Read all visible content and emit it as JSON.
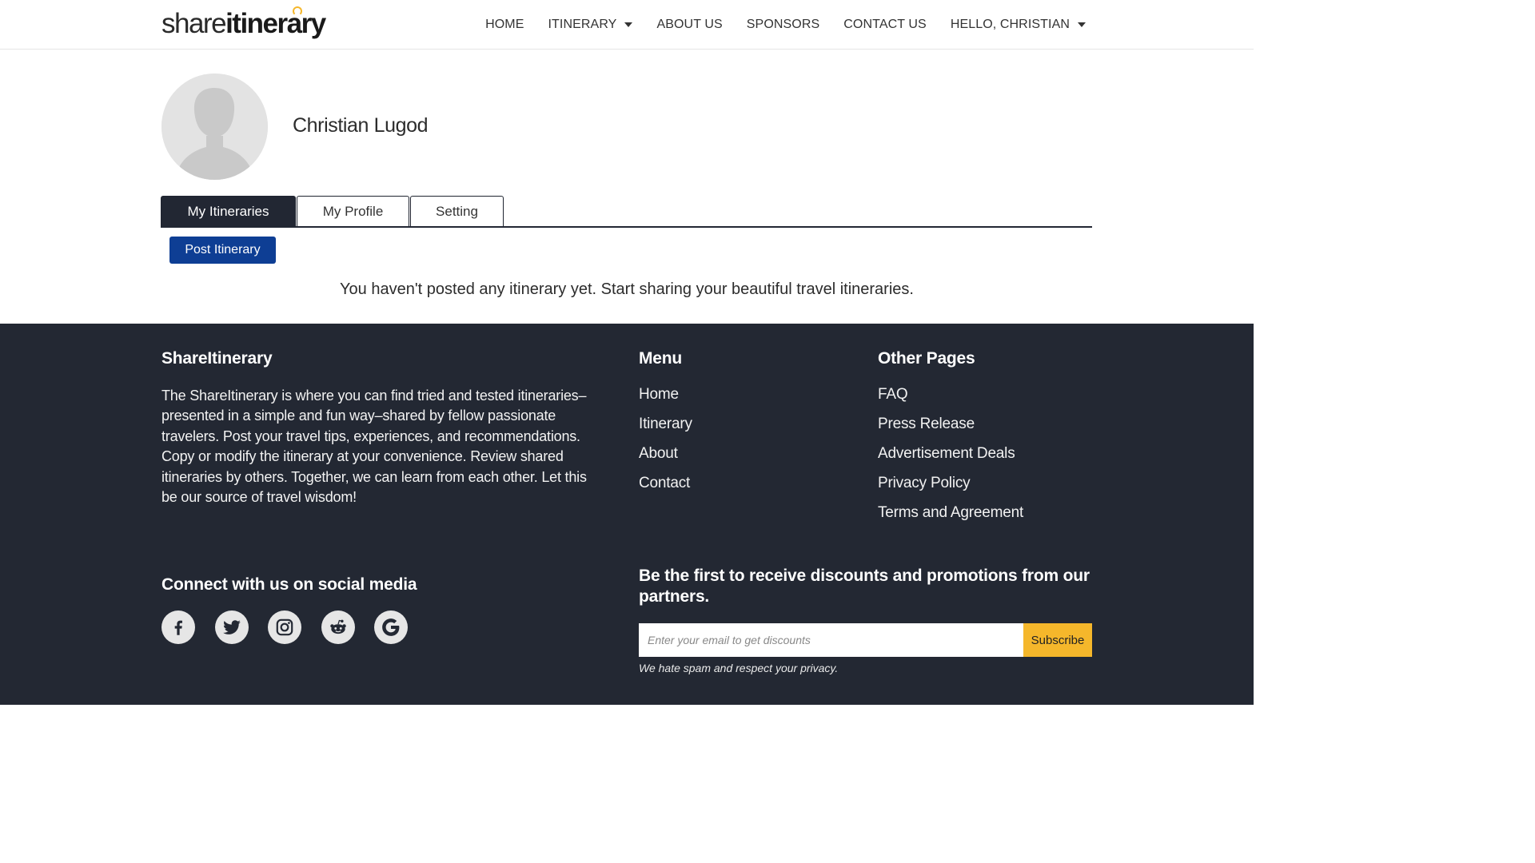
{
  "header": {
    "logo": {
      "part1": "share",
      "part2": "itinerary"
    },
    "nav": [
      {
        "label": "HOME",
        "dropdown": false
      },
      {
        "label": "ITINERARY",
        "dropdown": true
      },
      {
        "label": "ABOUT US",
        "dropdown": false
      },
      {
        "label": "SPONSORS",
        "dropdown": false
      },
      {
        "label": "CONTACT US",
        "dropdown": false
      },
      {
        "label": "HELLO, CHRISTIAN",
        "dropdown": true
      }
    ]
  },
  "profile": {
    "name": "Christian Lugod",
    "avatar_icon": "default-user-avatar"
  },
  "tabs": [
    {
      "label": "My Itineraries",
      "active": true
    },
    {
      "label": "My Profile",
      "active": false
    },
    {
      "label": "Setting",
      "active": false
    }
  ],
  "main": {
    "post_button": "Post Itinerary",
    "empty_message": "You haven't posted any itinerary yet. Start sharing your beautiful travel itineraries."
  },
  "footer": {
    "about_title": "ShareItinerary",
    "about_text": "The ShareItinerary is where you can find tried and tested itineraries–presented in a simple and fun way–shared by fellow passionate travelers. Post your travel tips, experiences, and recommendations. Copy or modify the itinerary at your convenience. Review shared itineraries by others. Together, we can learn from each other. Let this be our source of travel wisdom!",
    "menu_title": "Menu",
    "menu_links": [
      "Home",
      "Itinerary",
      "About",
      "Contact"
    ],
    "other_title": "Other Pages",
    "other_links": [
      "FAQ",
      "Press Release",
      "Advertisement Deals",
      "Privacy Policy",
      "Terms and Agreement"
    ],
    "social_title": "Connect with us on social media",
    "social_icons": [
      "facebook-icon",
      "twitter-icon",
      "instagram-icon",
      "reddit-icon",
      "google-icon"
    ],
    "promo_title": "Be the first to receive discounts and promotions from our partners.",
    "email_placeholder": "Enter your email to get discounts",
    "subscribe_label": "Subscribe",
    "privacy_note": "We hate spam and respect your privacy."
  },
  "colors": {
    "footer_bg": "#232833",
    "active_tab_bg": "#222733",
    "primary_button": "#0e3e94",
    "accent": "#f5b72b"
  }
}
